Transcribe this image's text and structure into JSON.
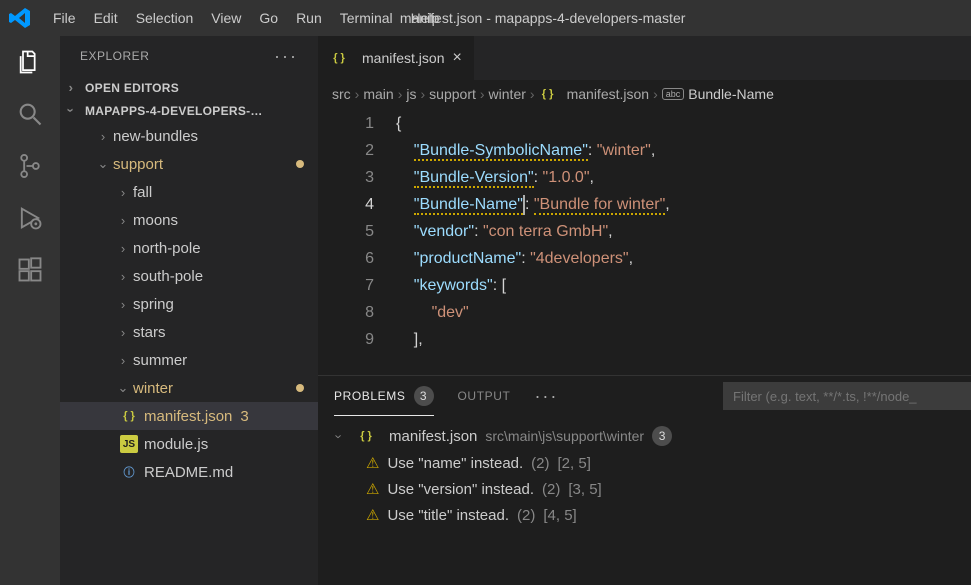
{
  "window": {
    "title": "manifest.json - mapapps-4-developers-master"
  },
  "menu": {
    "file": "File",
    "edit": "Edit",
    "selection": "Selection",
    "view": "View",
    "go": "Go",
    "run": "Run",
    "terminal": "Terminal",
    "help": "Help"
  },
  "explorer": {
    "title": "EXPLORER",
    "openEditors": "OPEN EDITORS",
    "project": "MAPAPPS-4-DEVELOPERS-…",
    "items": [
      {
        "label": "new-bundles",
        "indent": 36
      },
      {
        "label": "support",
        "indent": 36,
        "expanded": true,
        "mod": true
      },
      {
        "label": "fall",
        "indent": 56
      },
      {
        "label": "moons",
        "indent": 56
      },
      {
        "label": "north-pole",
        "indent": 56
      },
      {
        "label": "south-pole",
        "indent": 56
      },
      {
        "label": "spring",
        "indent": 56
      },
      {
        "label": "stars",
        "indent": 56
      },
      {
        "label": "summer",
        "indent": 56
      },
      {
        "label": "winter",
        "indent": 56,
        "expanded": true,
        "mod": true
      }
    ],
    "files": [
      {
        "label": "manifest.json",
        "icon": "json",
        "indent": 60,
        "badge": "3",
        "selected": true
      },
      {
        "label": "module.js",
        "icon": "js",
        "indent": 60
      },
      {
        "label": "README.md",
        "icon": "md",
        "indent": 60
      }
    ]
  },
  "tab": {
    "title": "manifest.json"
  },
  "crumbs": [
    "src",
    "main",
    "js",
    "support",
    "winter",
    "manifest.json",
    "Bundle-Name"
  ],
  "code": {
    "l1": "{",
    "l2": {
      "k": "\"Bundle-SymbolicName\"",
      "v": "\"winter\""
    },
    "l3": {
      "k": "\"Bundle-Version\"",
      "v": "\"1.0.0\""
    },
    "l4": {
      "k": "\"Bundle-Name\"",
      "v": "\"Bundle for winter\""
    },
    "l5": {
      "k": "\"vendor\"",
      "v": "\"con terra GmbH\""
    },
    "l6": {
      "k": "\"productName\"",
      "v": "\"4developers\""
    },
    "l7": {
      "k": "\"keywords\""
    },
    "l8": {
      "v": "\"dev\""
    },
    "l9": "],"
  },
  "panel": {
    "problems": "PROBLEMS",
    "output": "OUTPUT",
    "count": "3",
    "filterPlaceholder": "Filter (e.g. text, **/*.ts, !**/node_",
    "file": {
      "name": "manifest.json",
      "path": "src\\main\\js\\support\\winter",
      "count": "3"
    },
    "items": [
      {
        "msg": "Use \"name\" instead.",
        "src": "(2)",
        "loc": "[2, 5]"
      },
      {
        "msg": "Use \"version\" instead.",
        "src": "(2)",
        "loc": "[3, 5]"
      },
      {
        "msg": "Use \"title\" instead.",
        "src": "(2)",
        "loc": "[4, 5]"
      }
    ]
  }
}
